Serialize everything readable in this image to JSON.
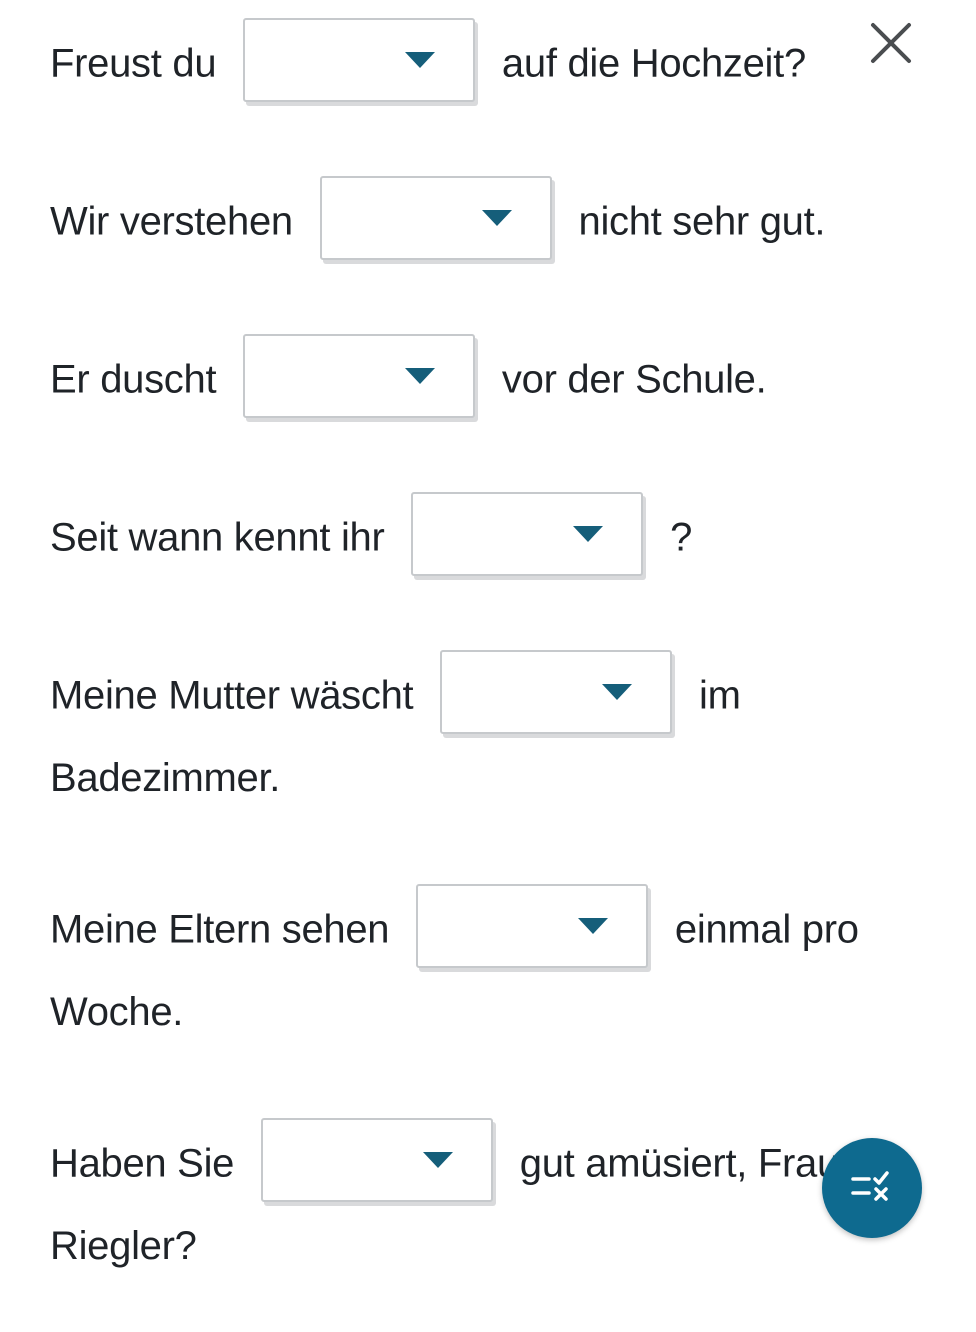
{
  "close_label": "Close",
  "submit_label": "Check answers",
  "exercise": {
    "items": [
      {
        "before": "Freust du",
        "after": "auf die Hochzeit?",
        "selected": ""
      },
      {
        "before": "Wir verstehen",
        "after": "nicht sehr gut.",
        "selected": ""
      },
      {
        "before": "Er duscht",
        "after": "vor der Schule.",
        "selected": ""
      },
      {
        "before": "Seit wann kennt ihr",
        "after": "?",
        "selected": ""
      },
      {
        "before": "Meine Mutter wäscht",
        "after": "im Badezimmer.",
        "selected": ""
      },
      {
        "before": "Meine Eltern sehen",
        "after": "einmal pro Woche.",
        "selected": ""
      },
      {
        "before": "Haben Sie",
        "after": "gut amüsiert, Frau Riegler?",
        "selected": ""
      }
    ]
  }
}
